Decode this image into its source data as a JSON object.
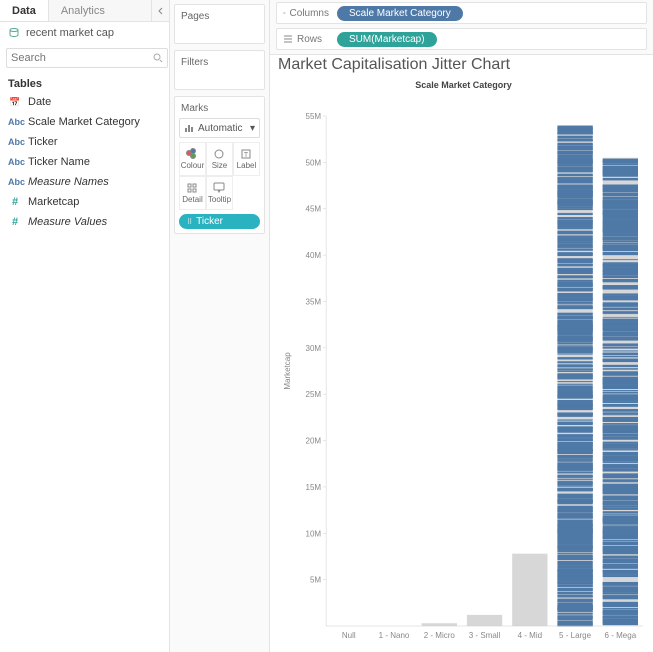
{
  "panel": {
    "tabs": {
      "data": "Data",
      "analytics": "Analytics"
    },
    "datasource": "recent market cap",
    "search_placeholder": "Search",
    "tables_header": "Tables",
    "fields": [
      {
        "icon": "date",
        "label": "Date",
        "italic": false
      },
      {
        "icon": "abc",
        "label": "Scale Market Category",
        "italic": false
      },
      {
        "icon": "abc",
        "label": "Ticker",
        "italic": false
      },
      {
        "icon": "abc",
        "label": "Ticker Name",
        "italic": false
      },
      {
        "icon": "abc",
        "label": "Measure Names",
        "italic": true
      },
      {
        "icon": "num",
        "label": "Marketcap",
        "italic": false
      },
      {
        "icon": "num",
        "label": "Measure Values",
        "italic": true
      }
    ]
  },
  "mid": {
    "pages": "Pages",
    "filters": "Filters",
    "marks": "Marks",
    "marks_type": "Automatic",
    "cells": {
      "colour": "Colour",
      "size": "Size",
      "label": "Label",
      "detail": "Detail",
      "tooltip": "Tooltip"
    },
    "pill_ticker": "Ticker"
  },
  "shelves": {
    "columns_label": "Columns",
    "rows_label": "Rows",
    "columns_pill": "Scale Market Category",
    "rows_pill": "SUM(Marketcap)"
  },
  "chart_data": {
    "type": "bar",
    "title": "Market Capitalisation Jitter Chart",
    "subtitle": "Scale Market Category",
    "ylabel": "Marketcap",
    "ylim": [
      0,
      55000000
    ],
    "yticks": [
      5000000,
      10000000,
      15000000,
      20000000,
      25000000,
      30000000,
      35000000,
      40000000,
      45000000,
      50000000,
      55000000
    ],
    "ytick_labels": [
      "5M",
      "10M",
      "15M",
      "20M",
      "25M",
      "30M",
      "35M",
      "40M",
      "45M",
      "50M",
      "55M"
    ],
    "categories": [
      "Null",
      "1 - Nano",
      "2 - Micro",
      "3 - Small",
      "4 - Mid",
      "5 - Large",
      "6 - Mega"
    ],
    "values": [
      0,
      0.05,
      0.3,
      1.2,
      7.8,
      54,
      50.5
    ],
    "value_unit_M": 1000000,
    "jitter_categories": [
      "5 - Large",
      "6 - Mega"
    ]
  }
}
